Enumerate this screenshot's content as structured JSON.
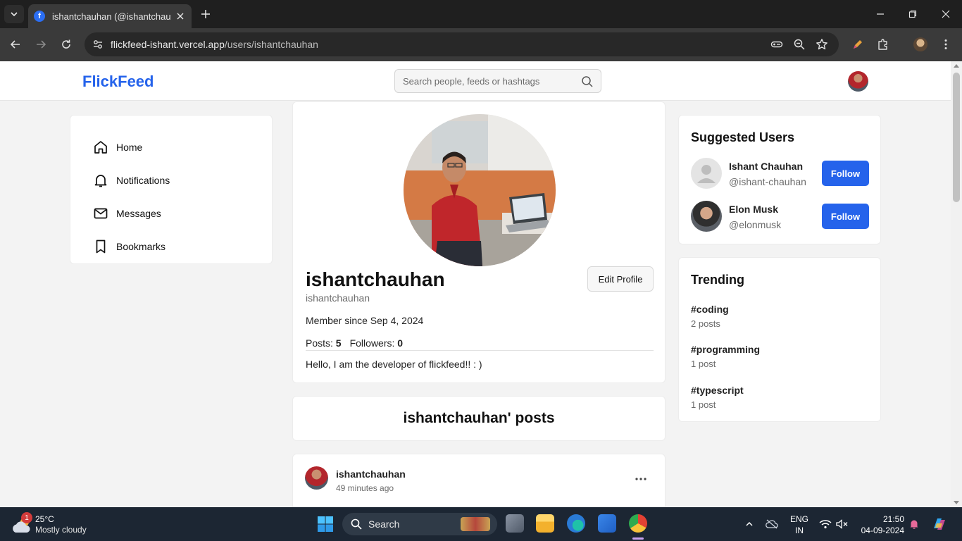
{
  "browser": {
    "tab_title": "ishantchauhan (@ishantchauhan",
    "tab_favicon": "f",
    "url_host": "flickfeed-ishant.vercel.app",
    "url_path": "/users/ishantchauhan"
  },
  "header": {
    "logo": "FlickFeed",
    "search_placeholder": "Search people, feeds or hashtags"
  },
  "sidebar": {
    "items": [
      {
        "label": "Home",
        "icon": "home-icon"
      },
      {
        "label": "Notifications",
        "icon": "bell-icon"
      },
      {
        "label": "Messages",
        "icon": "mail-icon"
      },
      {
        "label": "Bookmarks",
        "icon": "bookmark-icon"
      }
    ]
  },
  "profile": {
    "username": "ishantchauhan",
    "handle": "ishantchauhan",
    "edit_label": "Edit Profile",
    "member_since": "Member since Sep 4, 2024",
    "posts_label": "Posts:",
    "posts_count": "5",
    "followers_label": "Followers:",
    "followers_count": "0",
    "bio": "Hello, I am the developer of flickfeed!! : )"
  },
  "posts_section": {
    "title": "ishantchauhan' posts"
  },
  "post": {
    "author": "ishantchauhan",
    "time": "49 minutes ago"
  },
  "suggested": {
    "title": "Suggested Users",
    "users": [
      {
        "name": "Ishant Chauhan",
        "handle": "@ishant-chauhan",
        "follow_label": "Follow"
      },
      {
        "name": "Elon Musk",
        "handle": "@elonmusk",
        "follow_label": "Follow"
      }
    ]
  },
  "trending": {
    "title": "Trending",
    "items": [
      {
        "tag": "#coding",
        "count": "2 posts"
      },
      {
        "tag": "#programming",
        "count": "1 post"
      },
      {
        "tag": "#typescript",
        "count": "1 post"
      }
    ]
  },
  "taskbar": {
    "weather_badge": "1",
    "temperature": "25°C",
    "condition": "Mostly cloudy",
    "search_label": "Search",
    "lang_top": "ENG",
    "lang_bottom": "IN",
    "time": "21:50",
    "date": "04-09-2024"
  },
  "colors": {
    "brand": "#2563eb",
    "follow_button": "#2563eb",
    "taskbar": "#1c2633"
  }
}
